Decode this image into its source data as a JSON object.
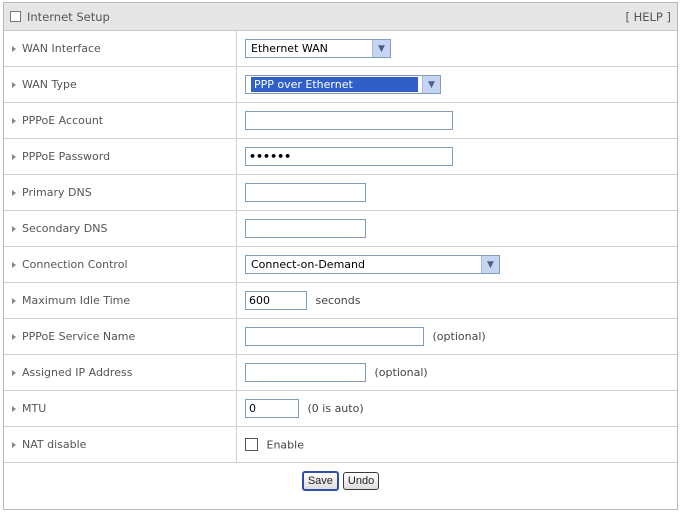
{
  "header": {
    "title": "Internet Setup",
    "help": "[ HELP ]"
  },
  "rows": {
    "wan_interface": {
      "label": "WAN Interface",
      "value": "Ethernet WAN"
    },
    "wan_type": {
      "label": "WAN Type",
      "value": "PPP over Ethernet"
    },
    "pppoe_account": {
      "label": "PPPoE Account",
      "value": ""
    },
    "pppoe_password": {
      "label": "PPPoE Password",
      "value": "••••••"
    },
    "primary_dns": {
      "label": "Primary DNS",
      "value": ""
    },
    "secondary_dns": {
      "label": "Secondary DNS",
      "value": ""
    },
    "connection_control": {
      "label": "Connection Control",
      "value": "Connect-on-Demand"
    },
    "max_idle_time": {
      "label": "Maximum Idle Time",
      "value": "600",
      "unit": "seconds"
    },
    "service_name": {
      "label": "PPPoE Service Name",
      "value": "",
      "note": "(optional)"
    },
    "assigned_ip": {
      "label": "Assigned IP Address",
      "value": "",
      "note": "(optional)"
    },
    "mtu": {
      "label": "MTU",
      "value": "0",
      "note": "(0 is auto)"
    },
    "nat_disable": {
      "label": "NAT disable",
      "checkbox_label": "Enable",
      "checked": false
    }
  },
  "buttons": {
    "save": "Save",
    "undo": "Undo"
  },
  "icons": {
    "header": "square-icon",
    "row_marker": "arrow-right-icon",
    "dropdown": "chevron-down-icon"
  },
  "colors": {
    "highlight": "#2f5fc7",
    "header_bg": "#e6e6e6"
  }
}
